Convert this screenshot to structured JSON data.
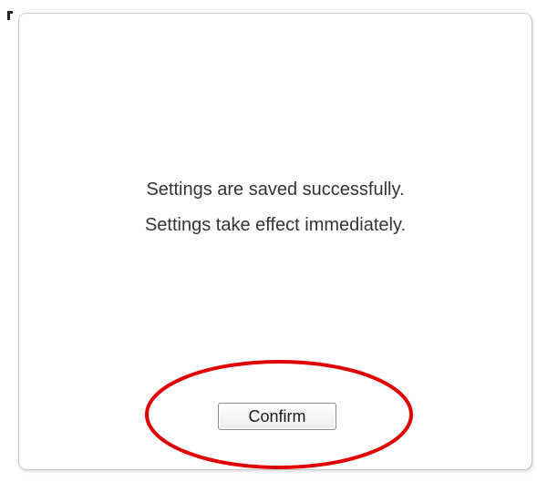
{
  "dialog": {
    "message_lines": [
      "Settings are saved successfully.",
      "Settings take effect immediately."
    ],
    "confirm_label": "Confirm"
  },
  "annotation": {
    "highlight_color": "#e00000"
  }
}
